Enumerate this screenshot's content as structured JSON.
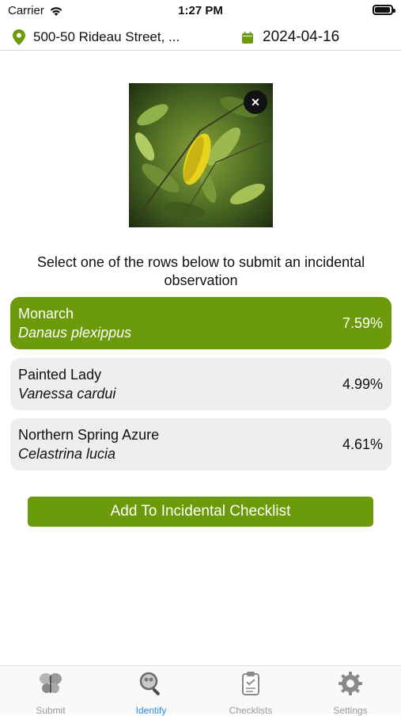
{
  "status_bar": {
    "carrier": "Carrier",
    "time": "1:27 PM"
  },
  "header": {
    "location": "500-50 Rideau Street, ...",
    "date": "2024-04-16"
  },
  "instructions": "Select one of the rows below to submit an incidental observation",
  "results": [
    {
      "common_name": "Monarch",
      "scientific_name": "Danaus plexippus",
      "percent": "7.59%",
      "selected": true
    },
    {
      "common_name": "Painted Lady",
      "scientific_name": "Vanessa cardui",
      "percent": "4.99%",
      "selected": false
    },
    {
      "common_name": "Northern Spring Azure",
      "scientific_name": "Celastrina lucia",
      "percent": "4.61%",
      "selected": false
    }
  ],
  "add_button": "Add To Incidental Checklist",
  "tabs": [
    {
      "label": "Submit",
      "icon": "butterfly-icon"
    },
    {
      "label": "Identify",
      "icon": "magnifier-icon"
    },
    {
      "label": "Checklists",
      "icon": "clipboard-icon"
    },
    {
      "label": "Settings",
      "icon": "gear-icon"
    }
  ],
  "active_tab": "Identify",
  "colors": {
    "accent": "#6b9a0a",
    "active_tab": "#2f8ae0",
    "row_bg": "#eeeeee"
  }
}
